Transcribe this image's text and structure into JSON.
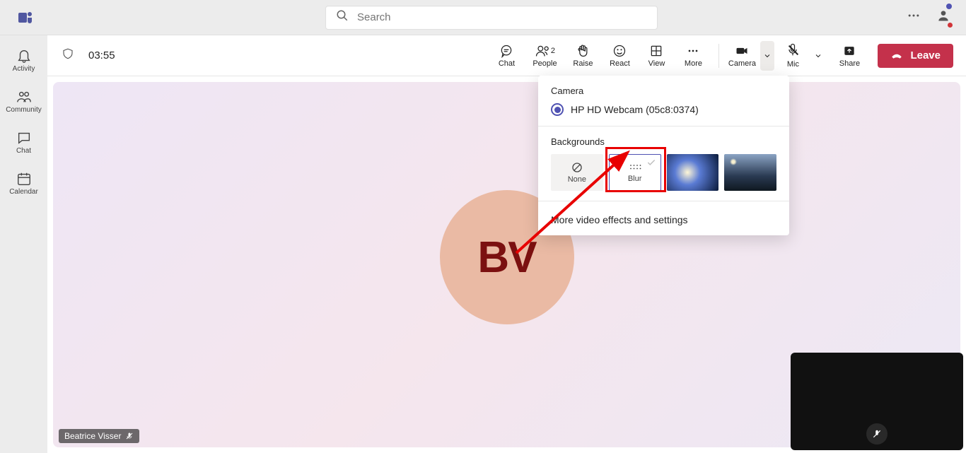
{
  "header": {
    "search_placeholder": "Search"
  },
  "left_rail": {
    "items": [
      {
        "label": "Activity"
      },
      {
        "label": "Community"
      },
      {
        "label": "Chat"
      },
      {
        "label": "Calendar"
      }
    ]
  },
  "meeting": {
    "timer": "03:55",
    "participant_initials": "BV",
    "participant_name": "Beatrice Visser"
  },
  "toolbar": {
    "chat": "Chat",
    "people": "People",
    "people_count": "2",
    "raise": "Raise",
    "react": "React",
    "view": "View",
    "more": "More",
    "camera": "Camera",
    "mic": "Mic",
    "share": "Share",
    "leave": "Leave"
  },
  "camera_popover": {
    "camera_title": "Camera",
    "camera_device": "HP HD Webcam (05c8:0374)",
    "bg_title": "Backgrounds",
    "bg_none": "None",
    "bg_blur": "Blur",
    "more_link": "More video effects and settings"
  }
}
